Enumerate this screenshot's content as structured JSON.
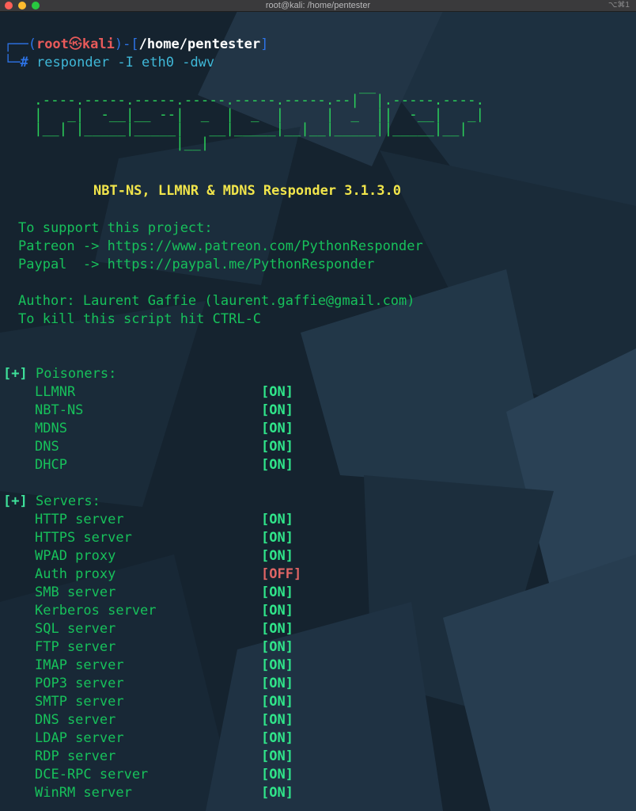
{
  "window": {
    "title": "root@kali: /home/pentester",
    "shortcut": "⌥⌘1"
  },
  "prompt": {
    "user": "root",
    "symbol": "㉿",
    "host": "kali",
    "path": "/home/pentester",
    "hash": "#",
    "command": "responder",
    "args": " -I eth0 -dwv"
  },
  "banner": {
    "art": "                                         __\n  .----.-----.-----.-----.-----.-----.--|  |.-----.----.\n  |   _|  -__|__ --|  _  |  _  |     |  _  ||  -__|   _|\n  |__| |_____|_____|   __|_____|__|__|_____||_____|__|\n                   |__|",
    "subtitle": "NBT-NS, LLMNR & MDNS Responder 3.1.3.0"
  },
  "info": {
    "support": "To support this project:",
    "patreon": "Patreon -> https://www.patreon.com/PythonResponder",
    "paypal": "Paypal  -> https://paypal.me/PythonResponder",
    "author": "Author: Laurent Gaffie (laurent.gaffie@gmail.com)",
    "kill": "To kill this script hit CTRL-C"
  },
  "poisoners": {
    "marker": "[+]",
    "header": "Poisoners:",
    "items": [
      {
        "name": "LLMNR",
        "status": "[ON]"
      },
      {
        "name": "NBT-NS",
        "status": "[ON]"
      },
      {
        "name": "MDNS",
        "status": "[ON]"
      },
      {
        "name": "DNS",
        "status": "[ON]"
      },
      {
        "name": "DHCP",
        "status": "[ON]"
      }
    ]
  },
  "servers": {
    "marker": "[+]",
    "header": "Servers:",
    "items": [
      {
        "name": "HTTP server",
        "status": "[ON]"
      },
      {
        "name": "HTTPS server",
        "status": "[ON]"
      },
      {
        "name": "WPAD proxy",
        "status": "[ON]"
      },
      {
        "name": "Auth proxy",
        "status": "[OFF]"
      },
      {
        "name": "SMB server",
        "status": "[ON]"
      },
      {
        "name": "Kerberos server",
        "status": "[ON]"
      },
      {
        "name": "SQL server",
        "status": "[ON]"
      },
      {
        "name": "FTP server",
        "status": "[ON]"
      },
      {
        "name": "IMAP server",
        "status": "[ON]"
      },
      {
        "name": "POP3 server",
        "status": "[ON]"
      },
      {
        "name": "SMTP server",
        "status": "[ON]"
      },
      {
        "name": "DNS server",
        "status": "[ON]"
      },
      {
        "name": "LDAP server",
        "status": "[ON]"
      },
      {
        "name": "RDP server",
        "status": "[ON]"
      },
      {
        "name": "DCE-RPC server",
        "status": "[ON]"
      },
      {
        "name": "WinRM server",
        "status": "[ON]"
      }
    ]
  }
}
